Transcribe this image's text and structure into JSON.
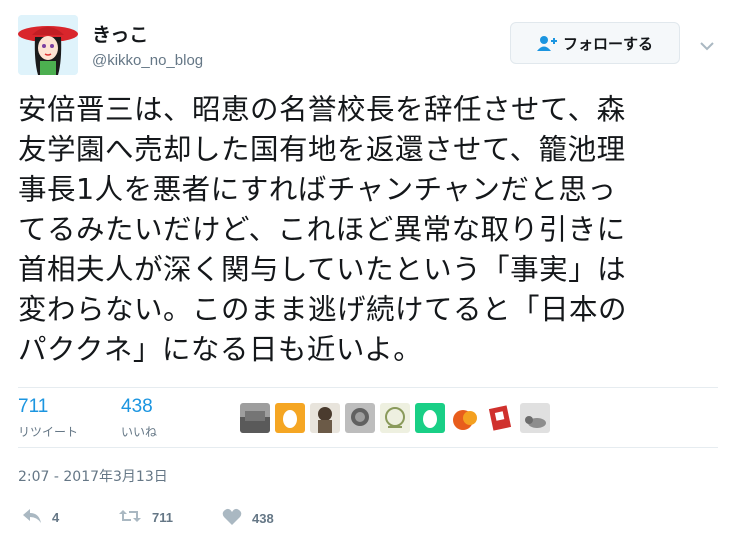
{
  "author": {
    "display_name": "きっこ",
    "handle": "@kikko_no_blog"
  },
  "follow_button": {
    "label": "フォローする",
    "icon": "add-user-icon"
  },
  "menu_icon": "chevron-down-icon",
  "tweet": {
    "lines": [
      "安倍晋三は、昭恵の名誉校長を辞任させて、森",
      "友学園へ売却した国有地を返還させて、籠池理",
      "事長1人を悪者にすればチャンチャンだと思っ",
      "てるみたいだけど、これほど異常な取り引きに",
      "首相夫人が深く関与していたという「事実」は",
      "変わらない。このまま逃げ続けてると「日本の",
      "パククネ」になる日も近いよ。"
    ]
  },
  "stats": {
    "retweets": {
      "count": "711",
      "label": "リツイート"
    },
    "likes": {
      "count": "438",
      "label": "いいね"
    }
  },
  "likers": [
    {
      "icon": "landscape-avatar",
      "color": "#6d6d6d"
    },
    {
      "icon": "egg-avatar",
      "color": "#f5a623"
    },
    {
      "icon": "doll-avatar",
      "color": "#4a3b2e"
    },
    {
      "icon": "sketch-avatar",
      "color": "#8a8a8a"
    },
    {
      "icon": "drawing-avatar",
      "color": "#c9d2b0"
    },
    {
      "icon": "egg-avatar",
      "color": "#19cf86"
    },
    {
      "icon": "fruit-avatar",
      "color": "#e85d1c"
    },
    {
      "icon": "card-avatar",
      "color": "#d0312d"
    },
    {
      "icon": "cat-avatar",
      "color": "#bdbdbd"
    }
  ],
  "timestamp": "2:07 - 2017年3月13日",
  "actions": {
    "reply": {
      "icon": "reply-icon",
      "count": "4"
    },
    "retweet": {
      "icon": "retweet-icon",
      "count": "711"
    },
    "like": {
      "icon": "heart-icon",
      "count": "438"
    }
  },
  "colors": {
    "accent": "#1b95e0",
    "muted": "#657786",
    "text": "#14171a",
    "divider": "#e6ecf0"
  }
}
